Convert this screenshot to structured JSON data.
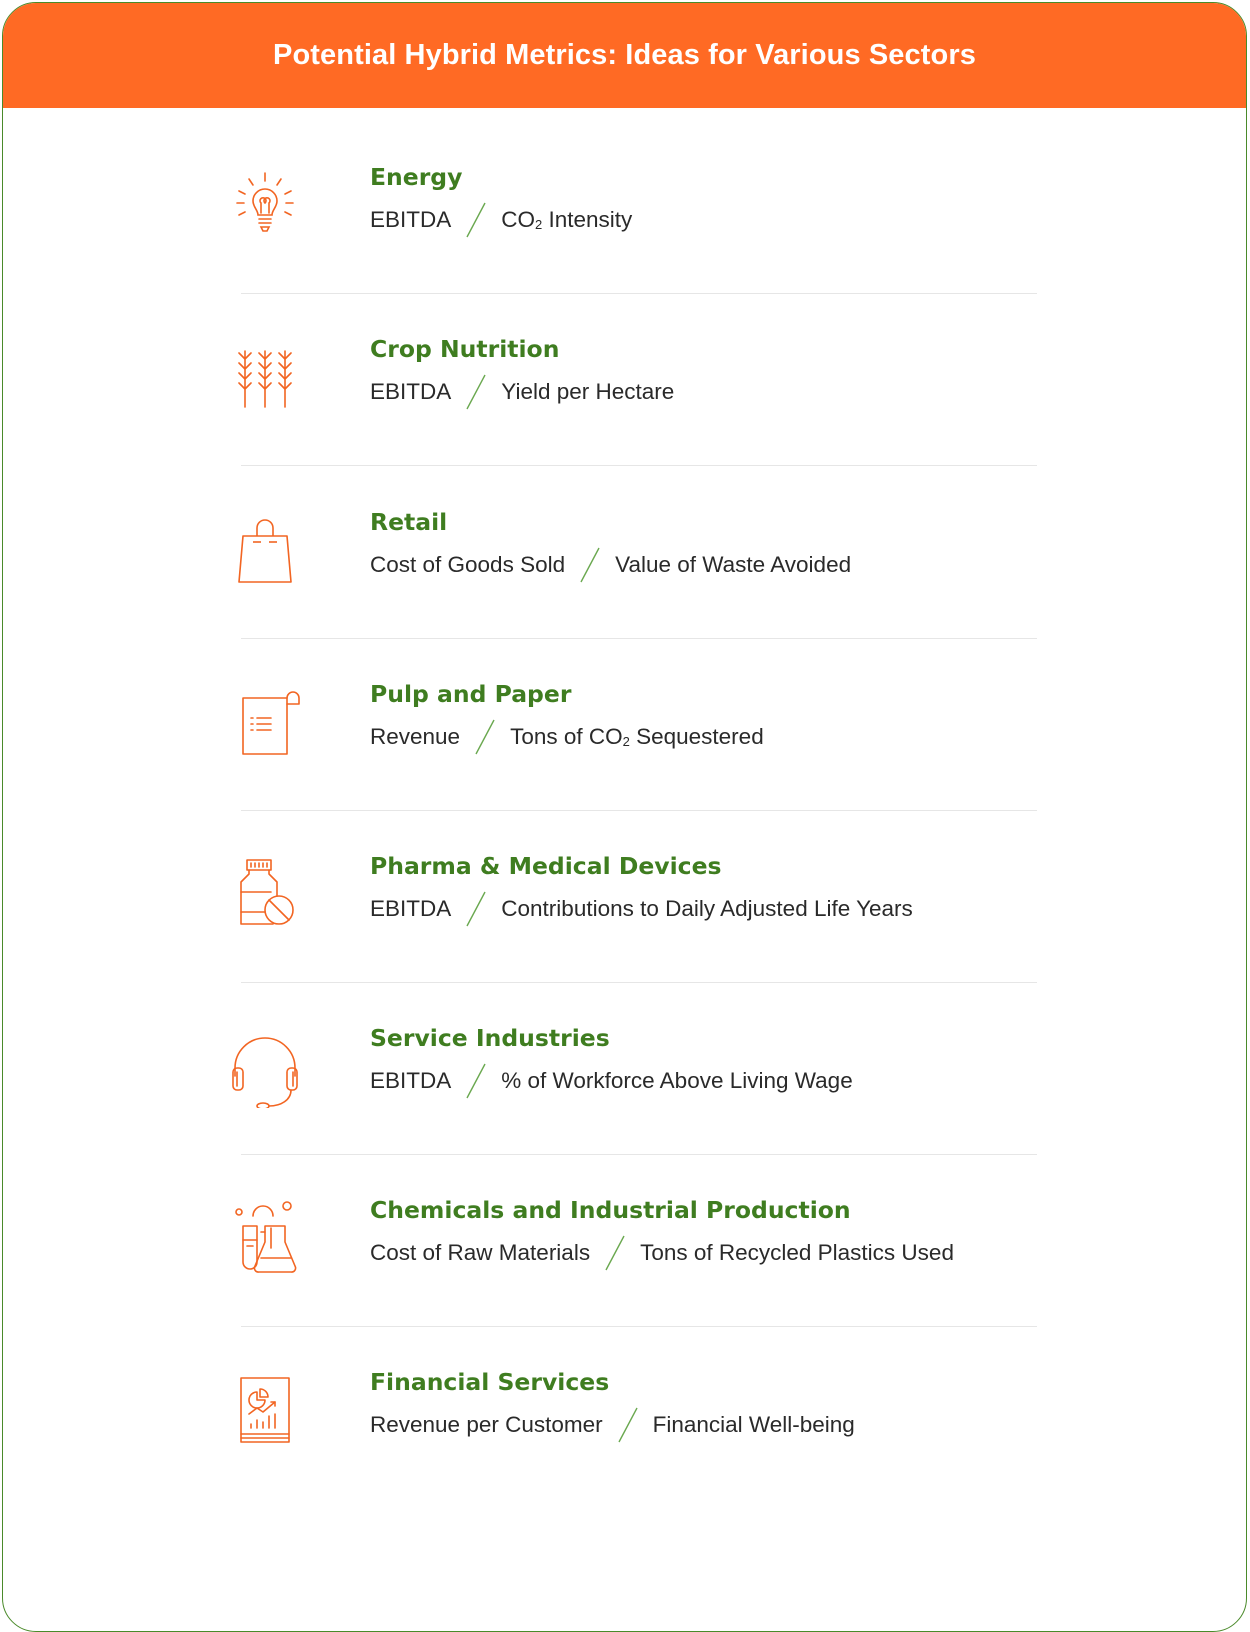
{
  "title": "Potential Hybrid Metrics: Ideas for Various Sectors",
  "sectors": [
    {
      "name": "Energy",
      "left": "EBITDA",
      "right_prefix": "CO",
      "right_sub": "2",
      "right_suffix": " Intensity",
      "icon": "lightbulb-icon"
    },
    {
      "name": "Crop Nutrition",
      "left": "EBITDA",
      "right": "Yield per Hectare",
      "icon": "wheat-icon"
    },
    {
      "name": "Retail",
      "left": "Cost of Goods Sold",
      "right": "Value of Waste Avoided",
      "icon": "shopping-bag-icon"
    },
    {
      "name": "Pulp and Paper",
      "left": "Revenue",
      "right_prefix": "Tons of CO",
      "right_sub": "2",
      "right_suffix": " Sequestered",
      "icon": "paper-scroll-icon"
    },
    {
      "name": "Pharma & Medical Devices",
      "left": "EBITDA",
      "right": "Contributions to Daily Adjusted Life Years",
      "icon": "medicine-bottle-icon"
    },
    {
      "name": "Service Industries",
      "left": "EBITDA",
      "right": "% of Workforce Above Living Wage",
      "icon": "headset-icon"
    },
    {
      "name": "Chemicals and Industrial Production",
      "left": "Cost of Raw Materials",
      "right": "Tons of Recycled Plastics Used",
      "icon": "lab-flask-icon"
    },
    {
      "name": "Financial Services",
      "left": "Revenue per Customer",
      "right": "Financial Well-being",
      "icon": "financial-report-icon"
    }
  ],
  "colors": {
    "header": "#ff6a24",
    "title_green": "#3f7d20",
    "icon_orange": "#f26522",
    "slash_green": "#6aa84f",
    "border": "#4a8a2a"
  }
}
